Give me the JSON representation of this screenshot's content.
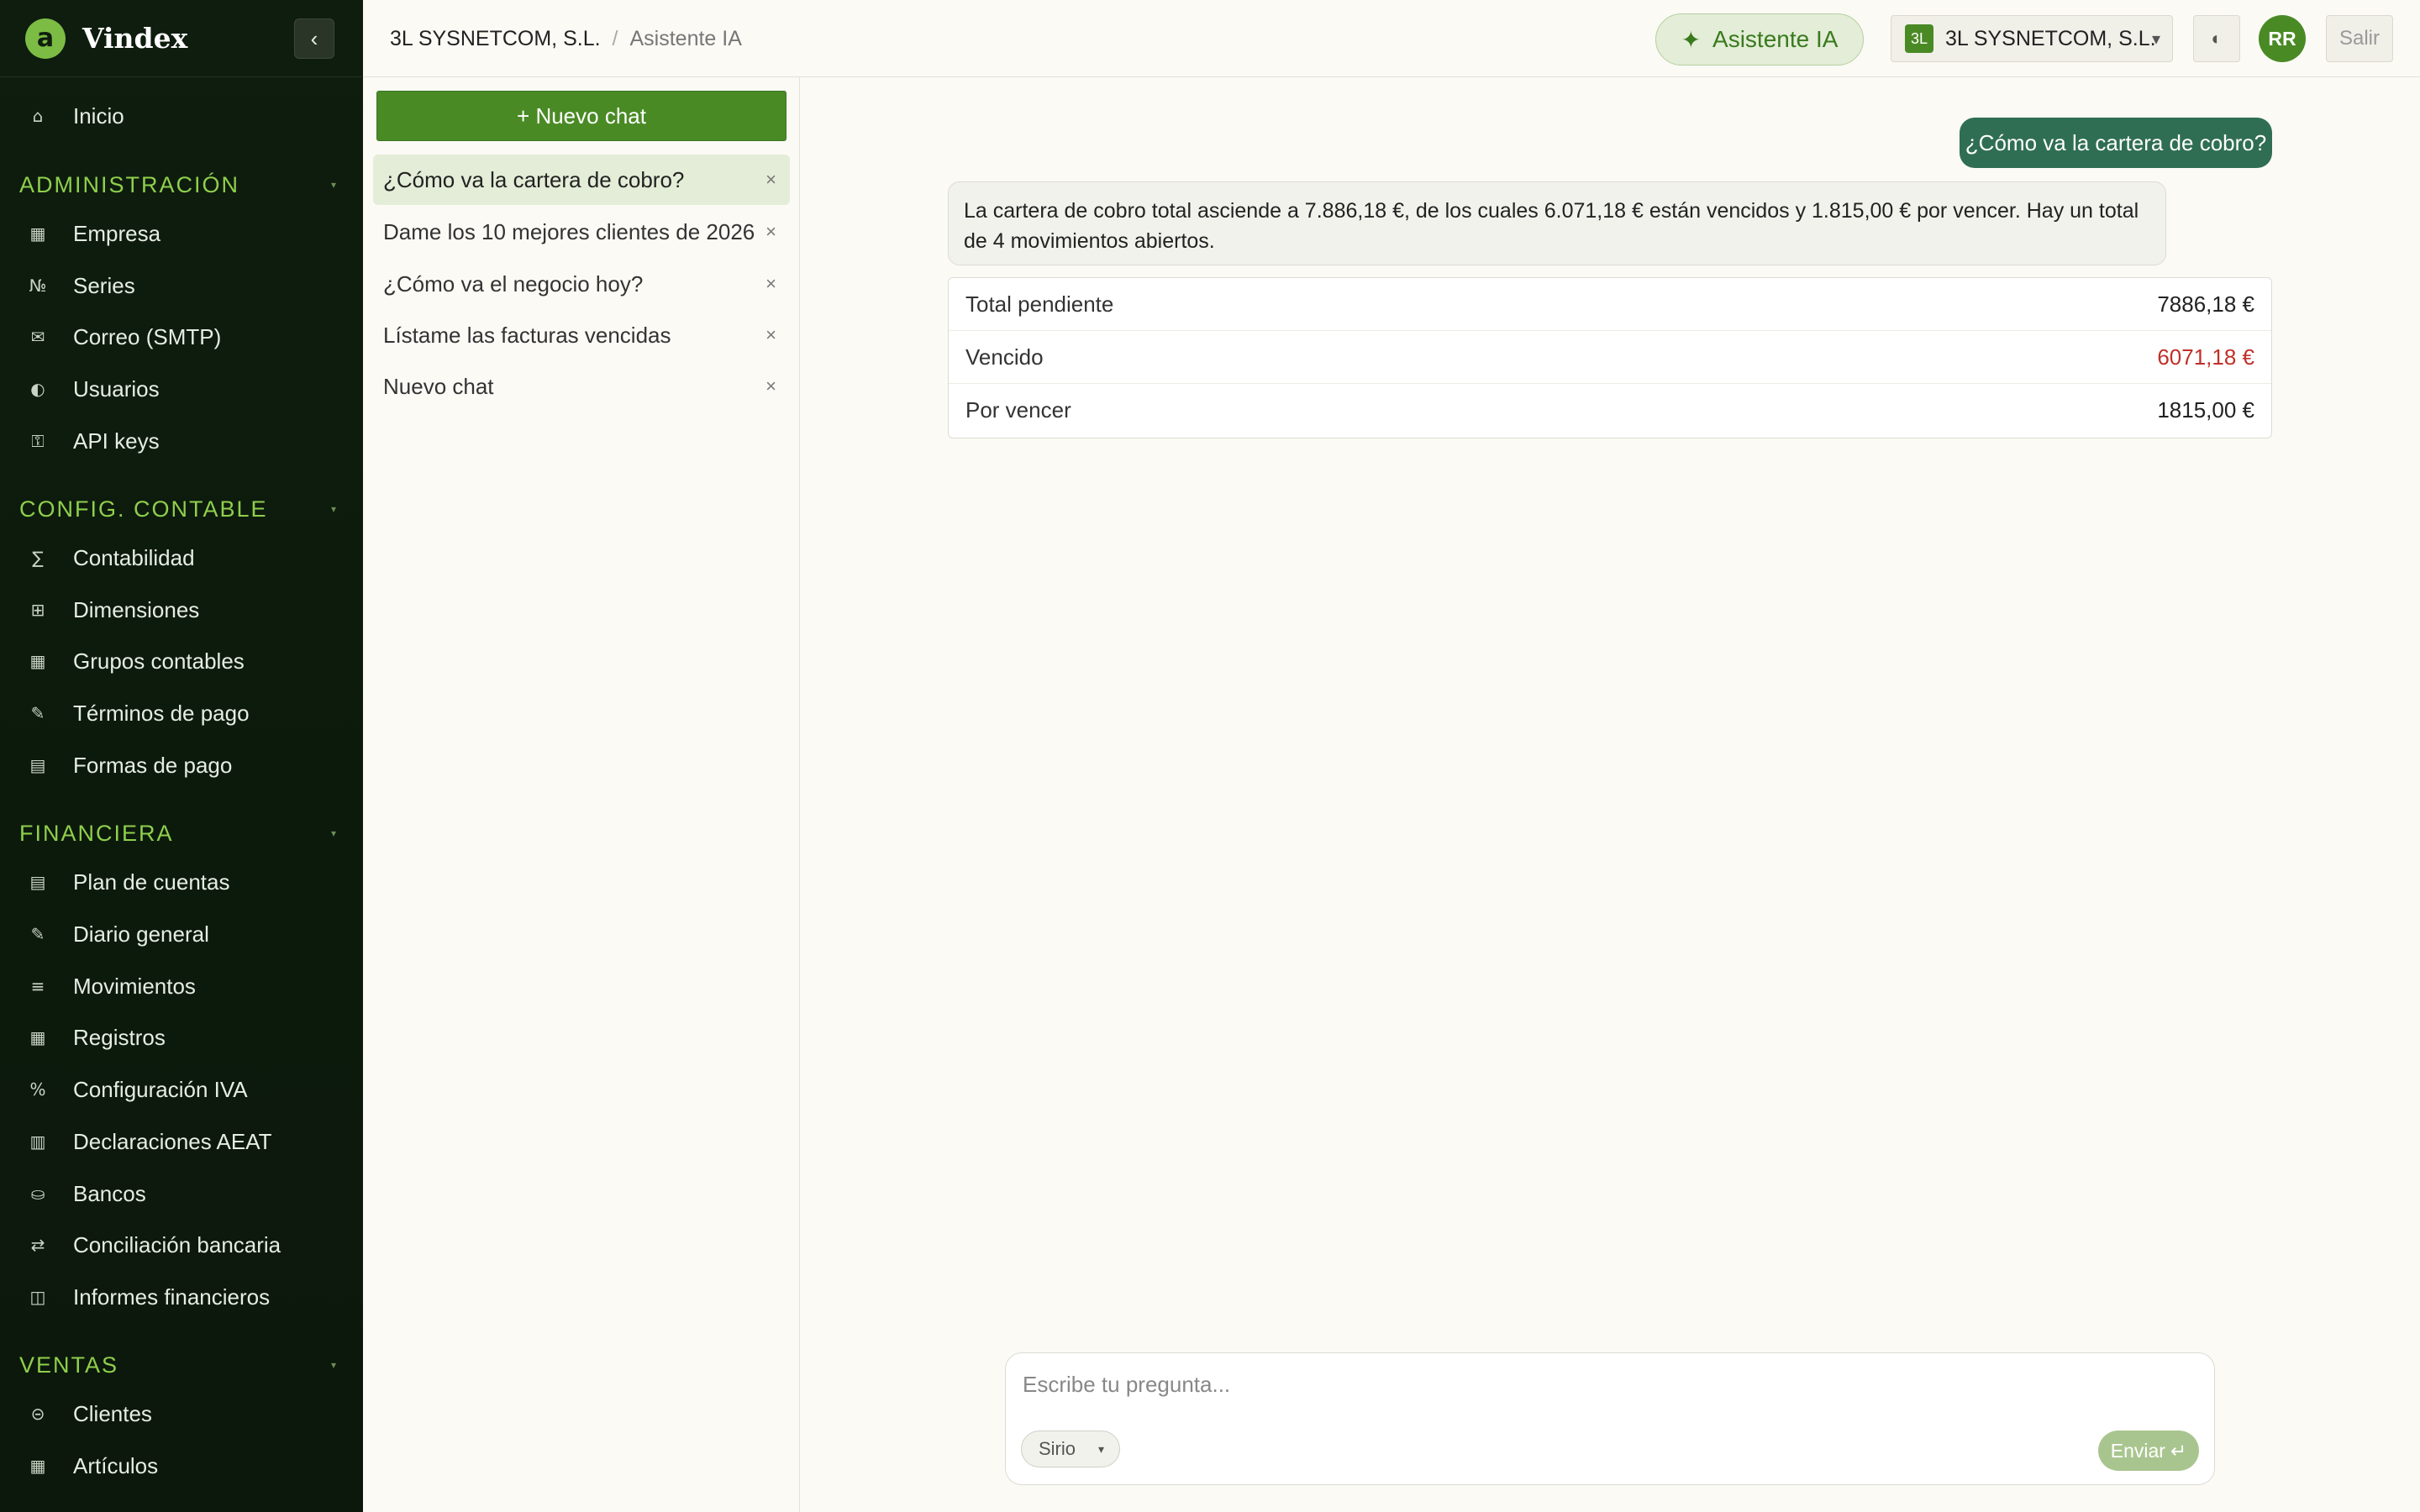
{
  "sidebar": {
    "brand": "Vindex",
    "logo_letter": "a",
    "collapse_icon": "‹",
    "top_item": {
      "icon": "⌂",
      "label": "Inicio"
    },
    "sections": [
      {
        "title": "ADMINISTRACIÓN",
        "items": [
          {
            "icon": "▦",
            "label": "Empresa"
          },
          {
            "icon": "№",
            "label": "Series"
          },
          {
            "icon": "✉",
            "label": "Correo (SMTP)"
          },
          {
            "icon": "◐",
            "label": "Usuarios"
          },
          {
            "icon": "⚿",
            "label": "API keys"
          }
        ]
      },
      {
        "title": "CONFIG. CONTABLE",
        "items": [
          {
            "icon": "∑",
            "label": "Contabilidad"
          },
          {
            "icon": "⊞",
            "label": "Dimensiones"
          },
          {
            "icon": "▦",
            "label": "Grupos contables"
          },
          {
            "icon": "✎",
            "label": "Términos de pago"
          },
          {
            "icon": "▤",
            "label": "Formas de pago"
          }
        ]
      },
      {
        "title": "FINANCIERA",
        "items": [
          {
            "icon": "▤",
            "label": "Plan de cuentas"
          },
          {
            "icon": "✎",
            "label": "Diario general"
          },
          {
            "icon": "≡",
            "label": "Movimientos"
          },
          {
            "icon": "▦",
            "label": "Registros"
          },
          {
            "icon": "%",
            "label": "Configuración IVA"
          },
          {
            "icon": "▥",
            "label": "Declaraciones AEAT"
          },
          {
            "icon": "⛀",
            "label": "Bancos"
          },
          {
            "icon": "⇄",
            "label": "Conciliación bancaria"
          },
          {
            "icon": "◫",
            "label": "Informes financieros"
          }
        ]
      },
      {
        "title": "VENTAS",
        "items": [
          {
            "icon": "⊝",
            "label": "Clientes"
          },
          {
            "icon": "▦",
            "label": "Artículos"
          }
        ]
      }
    ]
  },
  "topbar": {
    "breadcrumb_company": "3L SYSNETCOM, S.L.",
    "breadcrumb_separator": "/",
    "breadcrumb_page": "Asistente IA",
    "ai_button_icon": "✦",
    "ai_button_label": "Asistente IA",
    "company_badge": "3L",
    "company_name": "3L SYSNETCOM, S.L.",
    "company_arrow": "▾",
    "theme_icon": "◐",
    "avatar_initials": "RR",
    "logout_label": "Salir"
  },
  "chatlist": {
    "new_chat_label": "+ Nuevo chat",
    "close_icon": "×",
    "items": [
      {
        "title": "¿Cómo va la cartera de cobro?",
        "active": true
      },
      {
        "title": "Dame los 10 mejores clientes de 2026",
        "active": false
      },
      {
        "title": "¿Cómo va el negocio hoy?",
        "active": false
      },
      {
        "title": "Lístame las facturas vencidas",
        "active": false
      },
      {
        "title": "Nuevo chat",
        "active": false
      }
    ]
  },
  "conversation": {
    "user_message": "¿Cómo va la cartera de cobro?",
    "assistant_message": "La cartera de cobro total asciende a 7.886,18 €, de los cuales 6.071,18 € están vencidos y 1.815,00 € por vencer. Hay un total de 4 movimientos abiertos.",
    "table": [
      {
        "label": "Total pendiente",
        "value": "7886,18 €",
        "color": "#222222"
      },
      {
        "label": "Vencido",
        "value": "6071,18 €",
        "color": "#c0302a"
      },
      {
        "label": "Por vencer",
        "value": "1815,00 €",
        "color": "#222222"
      }
    ]
  },
  "composer": {
    "placeholder": "Escribe tu pregunta...",
    "model_label": "Sirio",
    "model_caret": "▾",
    "send_label": "Enviar",
    "send_icon": "↵"
  },
  "colors": {
    "accent": "#4a8a25",
    "sidebar_bg": "#0e1d0e",
    "section_title": "#8fcf4c",
    "user_bubble": "#2f6e52",
    "negative": "#c0302a"
  }
}
